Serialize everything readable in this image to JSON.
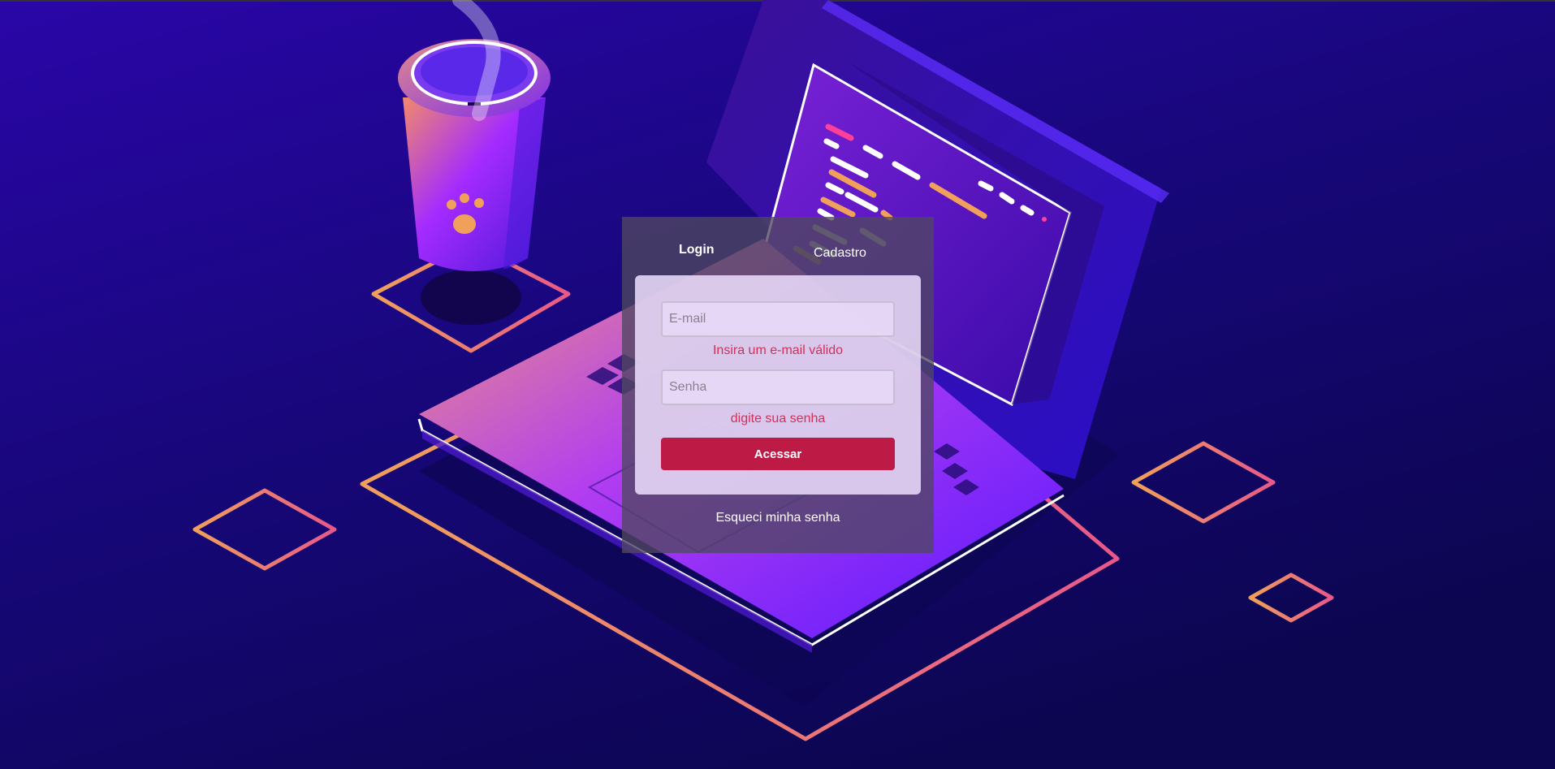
{
  "tabs": {
    "login_label": "Login",
    "cadastro_label": "Cadastro"
  },
  "form": {
    "email_placeholder": "E-mail",
    "email_error": "Insira um e-mail válido",
    "senha_placeholder": "Senha",
    "senha_error": "digite sua senha",
    "submit_label": "Acessar"
  },
  "forgot_password_label": "Esqueci minha senha",
  "colors": {
    "background": "#15066e",
    "accent": "#bd1b45",
    "error": "#d0305a",
    "outline_gradient_start": "#f0a05a",
    "outline_gradient_end": "#e8588a"
  },
  "illustration": {
    "icons": [
      "coffee-cup-icon",
      "paw-print-icon",
      "laptop-icon",
      "diamond-outline-icon"
    ]
  }
}
